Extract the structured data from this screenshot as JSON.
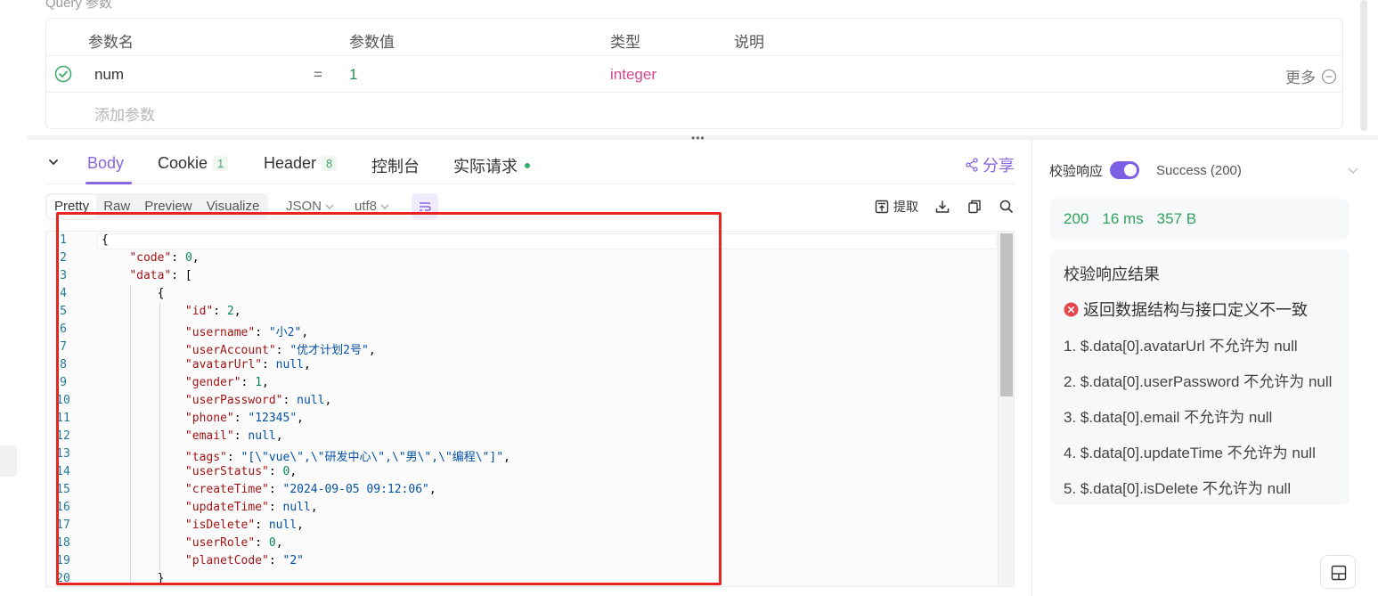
{
  "query": {
    "title": "Query 参数",
    "headers": {
      "name": "参数名",
      "value": "参数值",
      "type": "类型",
      "desc": "说明"
    },
    "rows": [
      {
        "name": "num",
        "op": "=",
        "value": "1",
        "type": "integer",
        "more": "更多"
      }
    ],
    "add_placeholder": "添加参数"
  },
  "splitter_dots": "•••",
  "response": {
    "tabs": [
      {
        "label": "Body",
        "active": true
      },
      {
        "label": "Cookie",
        "badge": "1"
      },
      {
        "label": "Header",
        "badge": "8"
      },
      {
        "label": "控制台"
      },
      {
        "label": "实际请求"
      }
    ],
    "share_label": "分享",
    "view_modes": [
      "Pretty",
      "Raw",
      "Preview",
      "Visualize"
    ],
    "format_select": "JSON",
    "encoding_select": "utf8",
    "extract_label": "提取"
  },
  "code": {
    "line_numbers": [
      "1",
      "2",
      "3",
      "4",
      "5",
      "6",
      "7",
      "8",
      "9",
      "10",
      "11",
      "12",
      "13",
      "14",
      "15",
      "16",
      "17",
      "18",
      "19",
      "20"
    ],
    "lines": [
      {
        "indent": "",
        "parts": [
          [
            "p",
            "{"
          ]
        ]
      },
      {
        "indent": "    ",
        "parts": [
          [
            "k",
            "\"code\""
          ],
          [
            "p",
            ": "
          ],
          [
            "n",
            "0"
          ],
          [
            "p",
            ","
          ]
        ]
      },
      {
        "indent": "    ",
        "parts": [
          [
            "k",
            "\"data\""
          ],
          [
            "p",
            ": ["
          ]
        ]
      },
      {
        "indent": "        ",
        "parts": [
          [
            "p",
            "{"
          ]
        ]
      },
      {
        "indent": "            ",
        "parts": [
          [
            "k",
            "\"id\""
          ],
          [
            "p",
            ": "
          ],
          [
            "n",
            "2"
          ],
          [
            "p",
            ","
          ]
        ]
      },
      {
        "indent": "            ",
        "parts": [
          [
            "k",
            "\"username\""
          ],
          [
            "p",
            ": "
          ],
          [
            "s",
            "\"小2\""
          ],
          [
            "p",
            ","
          ]
        ]
      },
      {
        "indent": "            ",
        "parts": [
          [
            "k",
            "\"userAccount\""
          ],
          [
            "p",
            ": "
          ],
          [
            "s",
            "\"优才计划2号\""
          ],
          [
            "p",
            ","
          ]
        ]
      },
      {
        "indent": "            ",
        "parts": [
          [
            "k",
            "\"avatarUrl\""
          ],
          [
            "p",
            ": "
          ],
          [
            "nl",
            "null"
          ],
          [
            "p",
            ","
          ]
        ]
      },
      {
        "indent": "            ",
        "parts": [
          [
            "k",
            "\"gender\""
          ],
          [
            "p",
            ": "
          ],
          [
            "n",
            "1"
          ],
          [
            "p",
            ","
          ]
        ]
      },
      {
        "indent": "            ",
        "parts": [
          [
            "k",
            "\"userPassword\""
          ],
          [
            "p",
            ": "
          ],
          [
            "nl",
            "null"
          ],
          [
            "p",
            ","
          ]
        ]
      },
      {
        "indent": "            ",
        "parts": [
          [
            "k",
            "\"phone\""
          ],
          [
            "p",
            ": "
          ],
          [
            "s",
            "\"12345\""
          ],
          [
            "p",
            ","
          ]
        ]
      },
      {
        "indent": "            ",
        "parts": [
          [
            "k",
            "\"email\""
          ],
          [
            "p",
            ": "
          ],
          [
            "nl",
            "null"
          ],
          [
            "p",
            ","
          ]
        ]
      },
      {
        "indent": "            ",
        "parts": [
          [
            "k",
            "\"tags\""
          ],
          [
            "p",
            ": "
          ],
          [
            "s",
            "\"[\\\"vue\\\",\\\"研发中心\\\",\\\"男\\\",\\\"编程\\\"]\""
          ],
          [
            "p",
            ","
          ]
        ]
      },
      {
        "indent": "            ",
        "parts": [
          [
            "k",
            "\"userStatus\""
          ],
          [
            "p",
            ": "
          ],
          [
            "n",
            "0"
          ],
          [
            "p",
            ","
          ]
        ]
      },
      {
        "indent": "            ",
        "parts": [
          [
            "k",
            "\"createTime\""
          ],
          [
            "p",
            ": "
          ],
          [
            "s",
            "\"2024-09-05 09:12:06\""
          ],
          [
            "p",
            ","
          ]
        ]
      },
      {
        "indent": "            ",
        "parts": [
          [
            "k",
            "\"updateTime\""
          ],
          [
            "p",
            ": "
          ],
          [
            "nl",
            "null"
          ],
          [
            "p",
            ","
          ]
        ]
      },
      {
        "indent": "            ",
        "parts": [
          [
            "k",
            "\"isDelete\""
          ],
          [
            "p",
            ": "
          ],
          [
            "nl",
            "null"
          ],
          [
            "p",
            ","
          ]
        ]
      },
      {
        "indent": "            ",
        "parts": [
          [
            "k",
            "\"userRole\""
          ],
          [
            "p",
            ": "
          ],
          [
            "n",
            "0"
          ],
          [
            "p",
            ","
          ]
        ]
      },
      {
        "indent": "            ",
        "parts": [
          [
            "k",
            "\"planetCode\""
          ],
          [
            "p",
            ": "
          ],
          [
            "s",
            "\"2\""
          ]
        ]
      },
      {
        "indent": "        ",
        "parts": [
          [
            "p",
            "}"
          ]
        ]
      }
    ]
  },
  "validation": {
    "label": "校验响应",
    "enabled": true,
    "status": "Success (200)",
    "stats": {
      "code": "200",
      "time": "16 ms",
      "size": "357 B"
    },
    "result_title": "校验响应结果",
    "error_message": "返回数据结构与接口定义不一致",
    "errors": [
      "1. $.data[0].avatarUrl 不允许为 null",
      "2. $.data[0].userPassword 不允许为 null",
      "3. $.data[0].email 不允许为 null",
      "4. $.data[0].updateTime 不允许为 null",
      "5. $.data[0].isDelete 不允许为 null"
    ]
  },
  "colors": {
    "accent": "#8866e0",
    "success": "#2fa35b",
    "error": "#e5484d",
    "highlight_box": "#e8251f"
  }
}
